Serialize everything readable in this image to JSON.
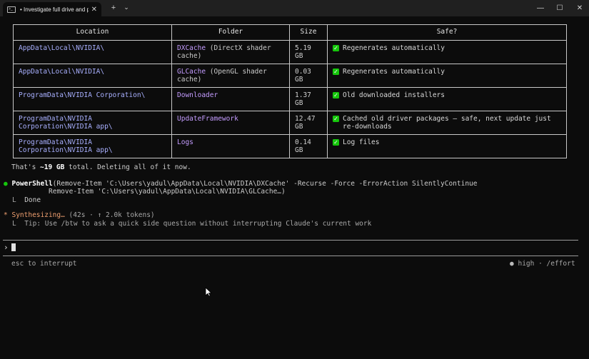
{
  "window": {
    "tab_title": "• Investigate full drive and pе",
    "tab_close": "✕",
    "new_tab": "+",
    "dropdown": "⌄",
    "minimize": "—",
    "maximize": "☐",
    "close": "✕",
    "icon_text": ">_"
  },
  "table": {
    "headers": [
      "Location",
      "Folder",
      "Size",
      "Safe?"
    ],
    "rows": [
      {
        "location": "AppData\\Local\\NVIDIA\\",
        "folder_name": "DXCache",
        "folder_desc": " (DirectX shader cache)",
        "size": "5.19 GB",
        "safe": "Regenerates automatically"
      },
      {
        "location": "AppData\\Local\\NVIDIA\\",
        "folder_name": "GLCache",
        "folder_desc": " (OpenGL shader cache)",
        "size": "0.03 GB",
        "safe": "Regenerates automatically"
      },
      {
        "location": "ProgramData\\NVIDIA Corporation\\",
        "folder_name": "Downloader",
        "folder_desc": "",
        "size": "1.37 GB",
        "safe": "Old downloaded installers"
      },
      {
        "location": "ProgramData\\NVIDIA Corporation\\NVIDIA app\\",
        "folder_name": "UpdateFramework",
        "folder_desc": "",
        "size": "12.47 GB",
        "safe": "Cached old driver packages — safe, next update just re-downloads"
      },
      {
        "location": "ProgramData\\NVIDIA Corporation\\NVIDIA app\\",
        "folder_name": "Logs",
        "folder_desc": "",
        "size": "0.14 GB",
        "safe": "Log files"
      }
    ]
  },
  "summary": {
    "pre": "That's ",
    "amount": "~19 GB",
    "post": " total. Deleting all of it now."
  },
  "tool": {
    "bullet": "●",
    "name": "PowerShell",
    "line1": "(Remove-Item 'C:\\Users\\yadul\\AppData\\Local\\NVIDIA\\DXCache' -Recurse -Force -ErrorAction SilentlyContinue",
    "line2": "Remove-Item 'C:\\Users\\yadul\\AppData\\Local\\NVIDIA\\GLCache…)",
    "result_prefix": "L",
    "result": "Done"
  },
  "status": {
    "spinner": "*",
    "label": "Synthesizing…",
    "meta": " (42s · ↑ 2.0k tokens)",
    "tip_prefix": "L",
    "tip": "Tip: Use /btw to ask a quick side question without interrupting Claude's current work"
  },
  "prompt": {
    "symbol": "›",
    "value": ""
  },
  "footer": {
    "left": "esc to interrupt",
    "right_dot": "●",
    "right": "high · /effort"
  },
  "colors": {
    "location": "#a9b0ff",
    "folder": "#c49cff",
    "check": "#16c60c",
    "accent": "#f0a070"
  }
}
